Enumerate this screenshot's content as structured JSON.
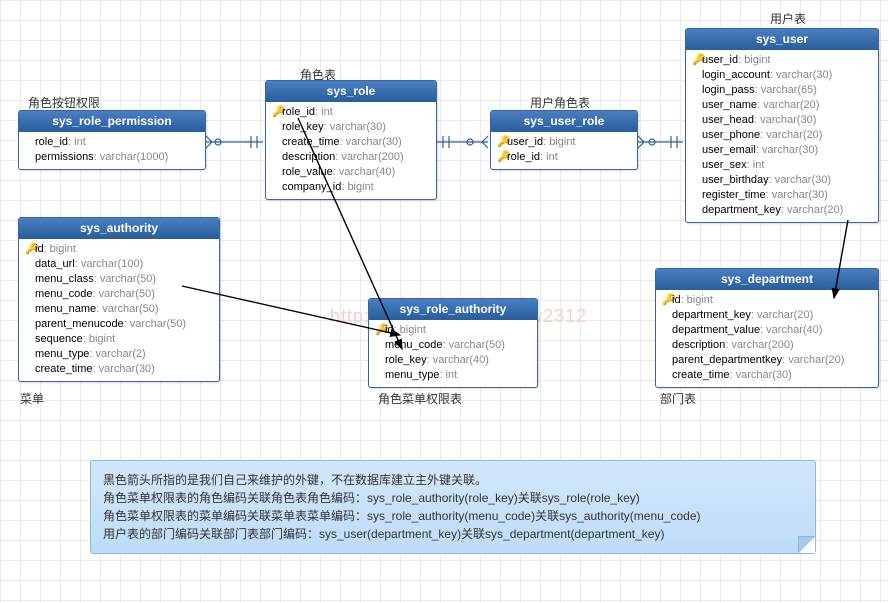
{
  "labels": {
    "sys_role_permission": "角色按钮权限",
    "sys_role": "角色表",
    "sys_user_role": "用户角色表",
    "sys_user": "用户表",
    "sys_authority": "菜单",
    "sys_role_authority": "角色菜单权限表",
    "sys_department": "部门表"
  },
  "entities": {
    "sys_role_permission": {
      "title": "sys_role_permission",
      "fields": [
        {
          "key": false,
          "name": "role_id",
          "type": "int"
        },
        {
          "key": false,
          "name": "permissions",
          "type": "varchar(1000)"
        }
      ]
    },
    "sys_role": {
      "title": "sys_role",
      "fields": [
        {
          "key": true,
          "name": "role_id",
          "type": "int"
        },
        {
          "key": false,
          "name": "role_key",
          "type": "varchar(30)"
        },
        {
          "key": false,
          "name": "create_time",
          "type": "varchar(30)"
        },
        {
          "key": false,
          "name": "description",
          "type": "varchar(200)"
        },
        {
          "key": false,
          "name": "role_value",
          "type": "varchar(40)"
        },
        {
          "key": false,
          "name": "company_id",
          "type": "bigint"
        }
      ]
    },
    "sys_user_role": {
      "title": "sys_user_role",
      "fields": [
        {
          "key": true,
          "name": "user_id",
          "type": "bigint"
        },
        {
          "key": true,
          "name": "role_id",
          "type": "int"
        }
      ]
    },
    "sys_user": {
      "title": "sys_user",
      "fields": [
        {
          "key": true,
          "name": "user_id",
          "type": "bigint"
        },
        {
          "key": false,
          "name": "login_account",
          "type": "varchar(30)"
        },
        {
          "key": false,
          "name": "login_pass",
          "type": "varchar(65)"
        },
        {
          "key": false,
          "name": "user_name",
          "type": "varchar(20)"
        },
        {
          "key": false,
          "name": "user_head",
          "type": "varchar(30)"
        },
        {
          "key": false,
          "name": "user_phone",
          "type": "varchar(20)"
        },
        {
          "key": false,
          "name": "user_email",
          "type": "varchar(30)"
        },
        {
          "key": false,
          "name": "user_sex",
          "type": "int"
        },
        {
          "key": false,
          "name": "user_birthday",
          "type": "varchar(30)"
        },
        {
          "key": false,
          "name": "register_time",
          "type": "varchar(30)"
        },
        {
          "key": false,
          "name": "department_key",
          "type": "varchar(20)"
        }
      ]
    },
    "sys_authority": {
      "title": "sys_authority",
      "fields": [
        {
          "key": true,
          "name": "id",
          "type": "bigint"
        },
        {
          "key": false,
          "name": "data_url",
          "type": "varchar(100)"
        },
        {
          "key": false,
          "name": "menu_class",
          "type": "varchar(50)"
        },
        {
          "key": false,
          "name": "menu_code",
          "type": "varchar(50)"
        },
        {
          "key": false,
          "name": "menu_name",
          "type": "varchar(50)"
        },
        {
          "key": false,
          "name": "parent_menucode",
          "type": "varchar(50)"
        },
        {
          "key": false,
          "name": "sequence",
          "type": "bigint"
        },
        {
          "key": false,
          "name": "menu_type",
          "type": "varchar(2)"
        },
        {
          "key": false,
          "name": "create_time",
          "type": "varchar(30)"
        }
      ]
    },
    "sys_role_authority": {
      "title": "sys_role_authority",
      "fields": [
        {
          "key": true,
          "name": "id",
          "type": "bigint"
        },
        {
          "key": false,
          "name": "menu_code",
          "type": "varchar(50)"
        },
        {
          "key": false,
          "name": "role_key",
          "type": "varchar(40)"
        },
        {
          "key": false,
          "name": "menu_type",
          "type": "int"
        }
      ]
    },
    "sys_department": {
      "title": "sys_department",
      "fields": [
        {
          "key": true,
          "name": "id",
          "type": "bigint"
        },
        {
          "key": false,
          "name": "department_key",
          "type": "varchar(20)"
        },
        {
          "key": false,
          "name": "department_value",
          "type": "varchar(40)"
        },
        {
          "key": false,
          "name": "description",
          "type": "varchar(200)"
        },
        {
          "key": false,
          "name": "parent_departmentkey",
          "type": "varchar(20)"
        },
        {
          "key": false,
          "name": "create_time",
          "type": "varchar(30)"
        }
      ]
    }
  },
  "note": {
    "line1": "黑色箭头所指的是我们自己来维护的外键，不在数据库建立主外键关联。",
    "line2": "角色菜单权限表的角色编码关联角色表角色编码：sys_role_authority(role_key)关联sys_role(role_key)",
    "line3": "角色菜单权限表的菜单编码关联菜单表菜单编码：sys_role_authority(menu_code)关联sys_authority(menu_code)",
    "line4": "用户表的部门编码关联部门表部门编码：sys_user(department_key)关联sys_department(department_key)"
  },
  "watermark": "http://blog.csdn.net/hzw2312"
}
